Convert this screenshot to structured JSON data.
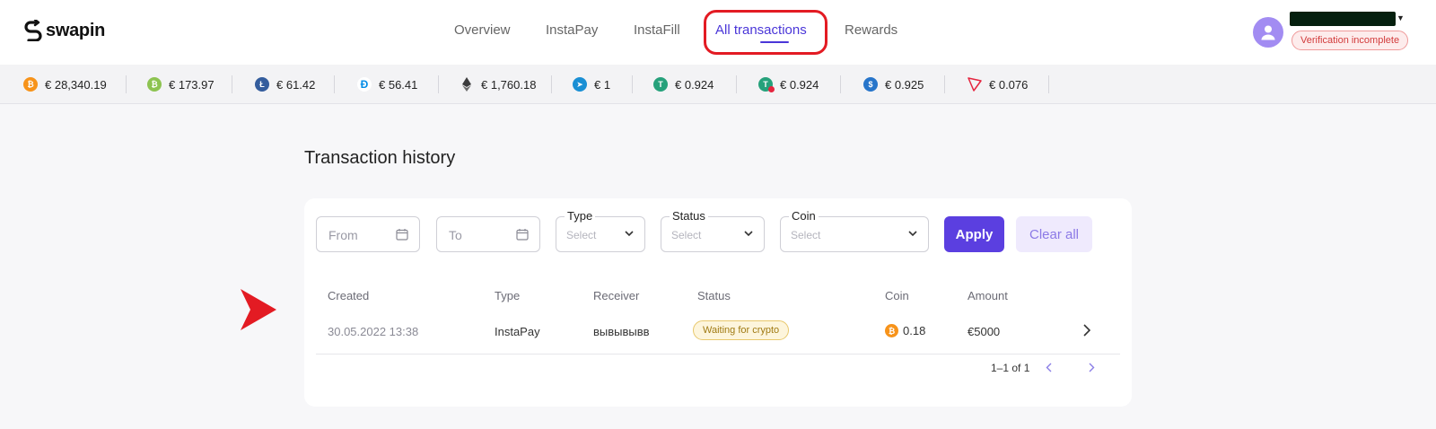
{
  "brand": {
    "name": "swapin"
  },
  "nav": {
    "items": [
      {
        "label": "Overview",
        "active": false
      },
      {
        "label": "InstaPay",
        "active": false
      },
      {
        "label": "InstaFill",
        "active": false
      },
      {
        "label": "All transactions",
        "active": true
      },
      {
        "label": "Rewards",
        "active": false
      }
    ]
  },
  "user": {
    "verification_label": "Verification incomplete"
  },
  "ticker": [
    {
      "icon": "bitcoin-icon",
      "color": "#f7931a",
      "price": "€ 28,340.19"
    },
    {
      "icon": "bitcoin-cash-icon",
      "color": "#8dc351",
      "price": "€ 173.97"
    },
    {
      "icon": "litecoin-icon",
      "color": "#345d9d",
      "price": "€ 61.42"
    },
    {
      "icon": "dash-icon",
      "color": "#008ce7",
      "price": "€ 56.41"
    },
    {
      "icon": "ethereum-icon",
      "color": "#3c3c3d",
      "price": "€ 1,760.18"
    },
    {
      "icon": "stellar-icon",
      "color": "#1a8fd4",
      "price": "€ 1"
    },
    {
      "icon": "tether-icon",
      "color": "#26a17b",
      "price": "€ 0.924"
    },
    {
      "icon": "tether-tron-icon",
      "color": "#26a17b",
      "price": "€ 0.924"
    },
    {
      "icon": "usd-coin-icon",
      "color": "#2775ca",
      "price": "€ 0.925"
    },
    {
      "icon": "tron-icon",
      "color": "#e5253f",
      "price": "€ 0.076"
    }
  ],
  "page": {
    "title": "Transaction history"
  },
  "filters": {
    "from_placeholder": "From",
    "to_placeholder": "To",
    "type": {
      "label": "Type",
      "value": "Select"
    },
    "status": {
      "label": "Status",
      "value": "Select"
    },
    "coin": {
      "label": "Coin",
      "value": "Select"
    },
    "apply_label": "Apply",
    "clear_label": "Clear all"
  },
  "table": {
    "columns": [
      "Created",
      "Type",
      "Receiver",
      "Status",
      "Coin",
      "Amount"
    ],
    "rows": [
      {
        "created": "30.05.2022 13:38",
        "type": "InstaPay",
        "receiver": "вывывывв",
        "status": "Waiting for crypto",
        "coin_icon": "bitcoin-icon",
        "coin": "0.18",
        "amount": "€5000"
      }
    ]
  },
  "pagination": {
    "label": "1–1 of 1"
  },
  "colors": {
    "accent": "#5b3fe0",
    "nav_active": "#4a36d8",
    "annotation": "#e31b23",
    "status_warning_bg": "#fdf5dc",
    "verification_bg": "#fdecec"
  }
}
